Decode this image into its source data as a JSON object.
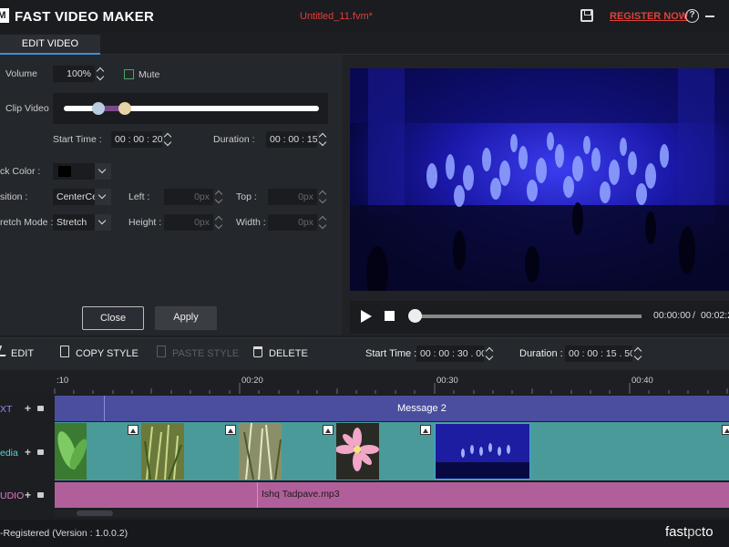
{
  "app": {
    "title": "FAST VIDEO MAKER",
    "logo_letter": "M",
    "file_name": "Untitled_11.fvm*",
    "register_label": "REGISTER NOW",
    "help_glyph": "?"
  },
  "tabs": [
    {
      "label": "EDIT VIDEO",
      "active": true
    }
  ],
  "edit": {
    "volume_label": "Volume",
    "volume_value": "100%",
    "mute_label": "Mute",
    "mute_checked": false,
    "clip_video_label": "Clip Video",
    "start_time_label": "Start Time :",
    "start_time_value": "00 : 00 : 20",
    "duration_label": "Duration :",
    "duration_value": "00 : 00 : 15",
    "back_color_label": "ck Color :",
    "back_color_value": "#000000",
    "position_label": "sition :",
    "position_value": "CenterCe",
    "left_label": "Left :",
    "left_value": "0px",
    "top_label": "Top :",
    "top_value": "0px",
    "stretch_label": "retch Mode :",
    "stretch_value": "Stretch",
    "height_label": "Height :",
    "height_value": "0px",
    "width_label": "Width :",
    "width_value": "0px",
    "close_label": "Close",
    "apply_label": "Apply"
  },
  "player": {
    "current_time": "00:00:00",
    "separator": "/",
    "total_time": "00:02:2",
    "progress": 0.0
  },
  "toolbar": {
    "edit_label": "EDIT",
    "copy_style_label": "COPY STYLE",
    "paste_style_label": "PASTE STYLE",
    "delete_label": "DELETE",
    "start_time_label": "Start Time :",
    "start_time_value": "00 : 00 : 30 . 00",
    "duration_label": "Duration :",
    "duration_value": "00 : 00 : 15 . 50"
  },
  "timeline": {
    "ticks": [
      ":10",
      "00:20",
      "00:30",
      "00:40"
    ],
    "tracks": {
      "text_label": "XT",
      "media_label": "edia",
      "audio_label": "UDIO"
    },
    "text_clip": "Message 2",
    "audio_clip": "Ishq Tadpave.mp3"
  },
  "status": {
    "text": "-Registered (Version : 1.0.0.2)",
    "brand_fast": "fast",
    "brand_pc": "pc",
    "brand_tail": "to"
  },
  "colors": {
    "accent": "#3b8fd6",
    "register": "#e0403a",
    "text_track": "#4b4e9e",
    "media_track": "#4a9a9a",
    "audio_track": "#b15f9a"
  }
}
